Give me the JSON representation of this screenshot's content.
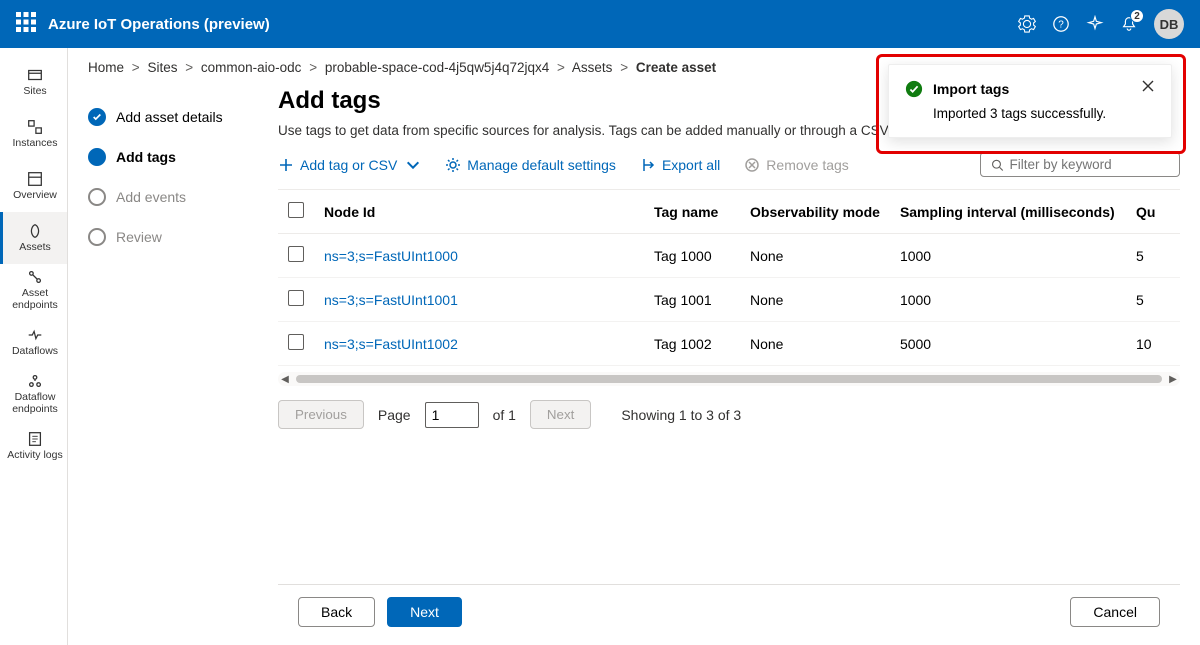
{
  "header": {
    "title": "Azure IoT Operations (preview)",
    "notification_count": "2",
    "avatar_initials": "DB"
  },
  "rail": {
    "items": [
      {
        "label": "Sites"
      },
      {
        "label": "Instances"
      },
      {
        "label": "Overview"
      },
      {
        "label": "Assets"
      },
      {
        "label": "Asset endpoints"
      },
      {
        "label": "Dataflows"
      },
      {
        "label": "Dataflow endpoints"
      },
      {
        "label": "Activity logs"
      }
    ]
  },
  "breadcrumb": {
    "home": "Home",
    "sites": "Sites",
    "site": "common-aio-odc",
    "instance": "probable-space-cod-4j5qw5j4q72jqx4",
    "assets": "Assets",
    "current": "Create asset"
  },
  "steps": {
    "s0": "Add asset details",
    "s1": "Add tags",
    "s2": "Add events",
    "s3": "Review"
  },
  "page": {
    "title": "Add tags",
    "desc": "Use tags to get data from specific sources for analysis. Tags can be added manually or through a CSV file."
  },
  "cmd": {
    "add": "Add tag or CSV",
    "manage": "Manage default settings",
    "export": "Export all",
    "remove": "Remove tags"
  },
  "filter": {
    "placeholder": "Filter by keyword"
  },
  "table": {
    "cols": {
      "node": "Node Id",
      "tag": "Tag name",
      "mode": "Observability mode",
      "interval": "Sampling interval (milliseconds)",
      "queue": "Qu"
    },
    "rows": [
      {
        "node": "ns=3;s=FastUInt1000",
        "tag": "Tag 1000",
        "mode": "None",
        "interval": "1000",
        "queue": "5"
      },
      {
        "node": "ns=3;s=FastUInt1001",
        "tag": "Tag 1001",
        "mode": "None",
        "interval": "1000",
        "queue": "5"
      },
      {
        "node": "ns=3;s=FastUInt1002",
        "tag": "Tag 1002",
        "mode": "None",
        "interval": "5000",
        "queue": "10"
      }
    ]
  },
  "pager": {
    "prev": "Previous",
    "page_label": "Page",
    "page_value": "1",
    "of_label": "of 1",
    "next": "Next",
    "showing": "Showing 1 to 3 of 3"
  },
  "footer": {
    "back": "Back",
    "next": "Next",
    "cancel": "Cancel"
  },
  "toast": {
    "title": "Import tags",
    "body": "Imported 3 tags successfully."
  }
}
